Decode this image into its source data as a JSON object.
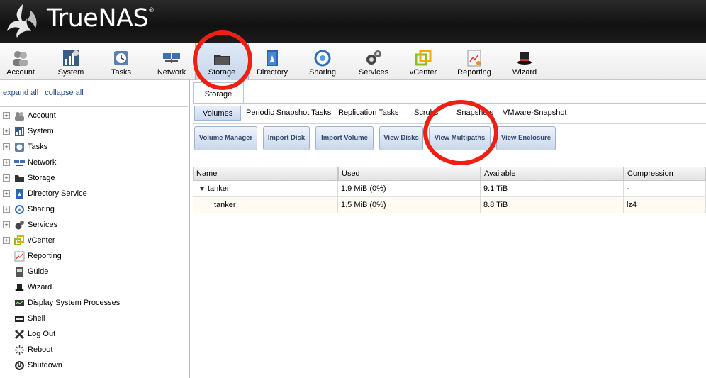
{
  "header": {
    "brand": "TrueNAS",
    "trademark": "®"
  },
  "toolbar": {
    "items": [
      {
        "label": "Account",
        "icon": "account-icon"
      },
      {
        "label": "System",
        "icon": "system-icon"
      },
      {
        "label": "Tasks",
        "icon": "tasks-icon"
      },
      {
        "label": "Network",
        "icon": "network-icon"
      },
      {
        "label": "Storage",
        "icon": "storage-icon",
        "active": true
      },
      {
        "label": "Directory",
        "icon": "directory-icon"
      },
      {
        "label": "Sharing",
        "icon": "sharing-icon"
      },
      {
        "label": "Services",
        "icon": "services-icon"
      },
      {
        "label": "vCenter",
        "icon": "vcenter-icon"
      },
      {
        "label": "Reporting",
        "icon": "reporting-icon"
      },
      {
        "label": "Wizard",
        "icon": "wizard-icon"
      }
    ]
  },
  "left": {
    "expand_all": "expand all",
    "collapse_all": "collapse all",
    "tree": [
      {
        "label": "Account",
        "expandable": true
      },
      {
        "label": "System",
        "expandable": true
      },
      {
        "label": "Tasks",
        "expandable": true
      },
      {
        "label": "Network",
        "expandable": true
      },
      {
        "label": "Storage",
        "expandable": true
      },
      {
        "label": "Directory Service",
        "expandable": true
      },
      {
        "label": "Sharing",
        "expandable": true
      },
      {
        "label": "Services",
        "expandable": true
      },
      {
        "label": "vCenter",
        "expandable": true
      },
      {
        "label": "Reporting",
        "expandable": false
      },
      {
        "label": "Guide",
        "expandable": false
      },
      {
        "label": "Wizard",
        "expandable": false
      },
      {
        "label": "Display System Processes",
        "expandable": false
      },
      {
        "label": "Shell",
        "expandable": false
      },
      {
        "label": "Log Out",
        "expandable": false
      },
      {
        "label": "Reboot",
        "expandable": false
      },
      {
        "label": "Shutdown",
        "expandable": false
      }
    ]
  },
  "main": {
    "tab": "Storage",
    "subtabs": [
      "Volumes",
      "Periodic Snapshot Tasks",
      "Replication Tasks",
      "Scrubs",
      "Snapshots",
      "VMware-Snapshot"
    ],
    "buttons": [
      "Volume Manager",
      "Import Disk",
      "Import Volume",
      "View Disks",
      "View Multipaths",
      "View Enclosure"
    ],
    "grid": {
      "columns": [
        "Name",
        "Used",
        "Available",
        "Compression"
      ],
      "rows": [
        [
          "tanker",
          "1.9 MiB (0%)",
          "9.1 TiB",
          "-"
        ],
        [
          "tanker",
          "1.5 MiB (0%)",
          "8.8 TiB",
          "lz4"
        ]
      ]
    }
  },
  "colors": {
    "annotation": "#ef1f14",
    "header_bg": "#151515",
    "active_tab": "#c6d6ec"
  }
}
